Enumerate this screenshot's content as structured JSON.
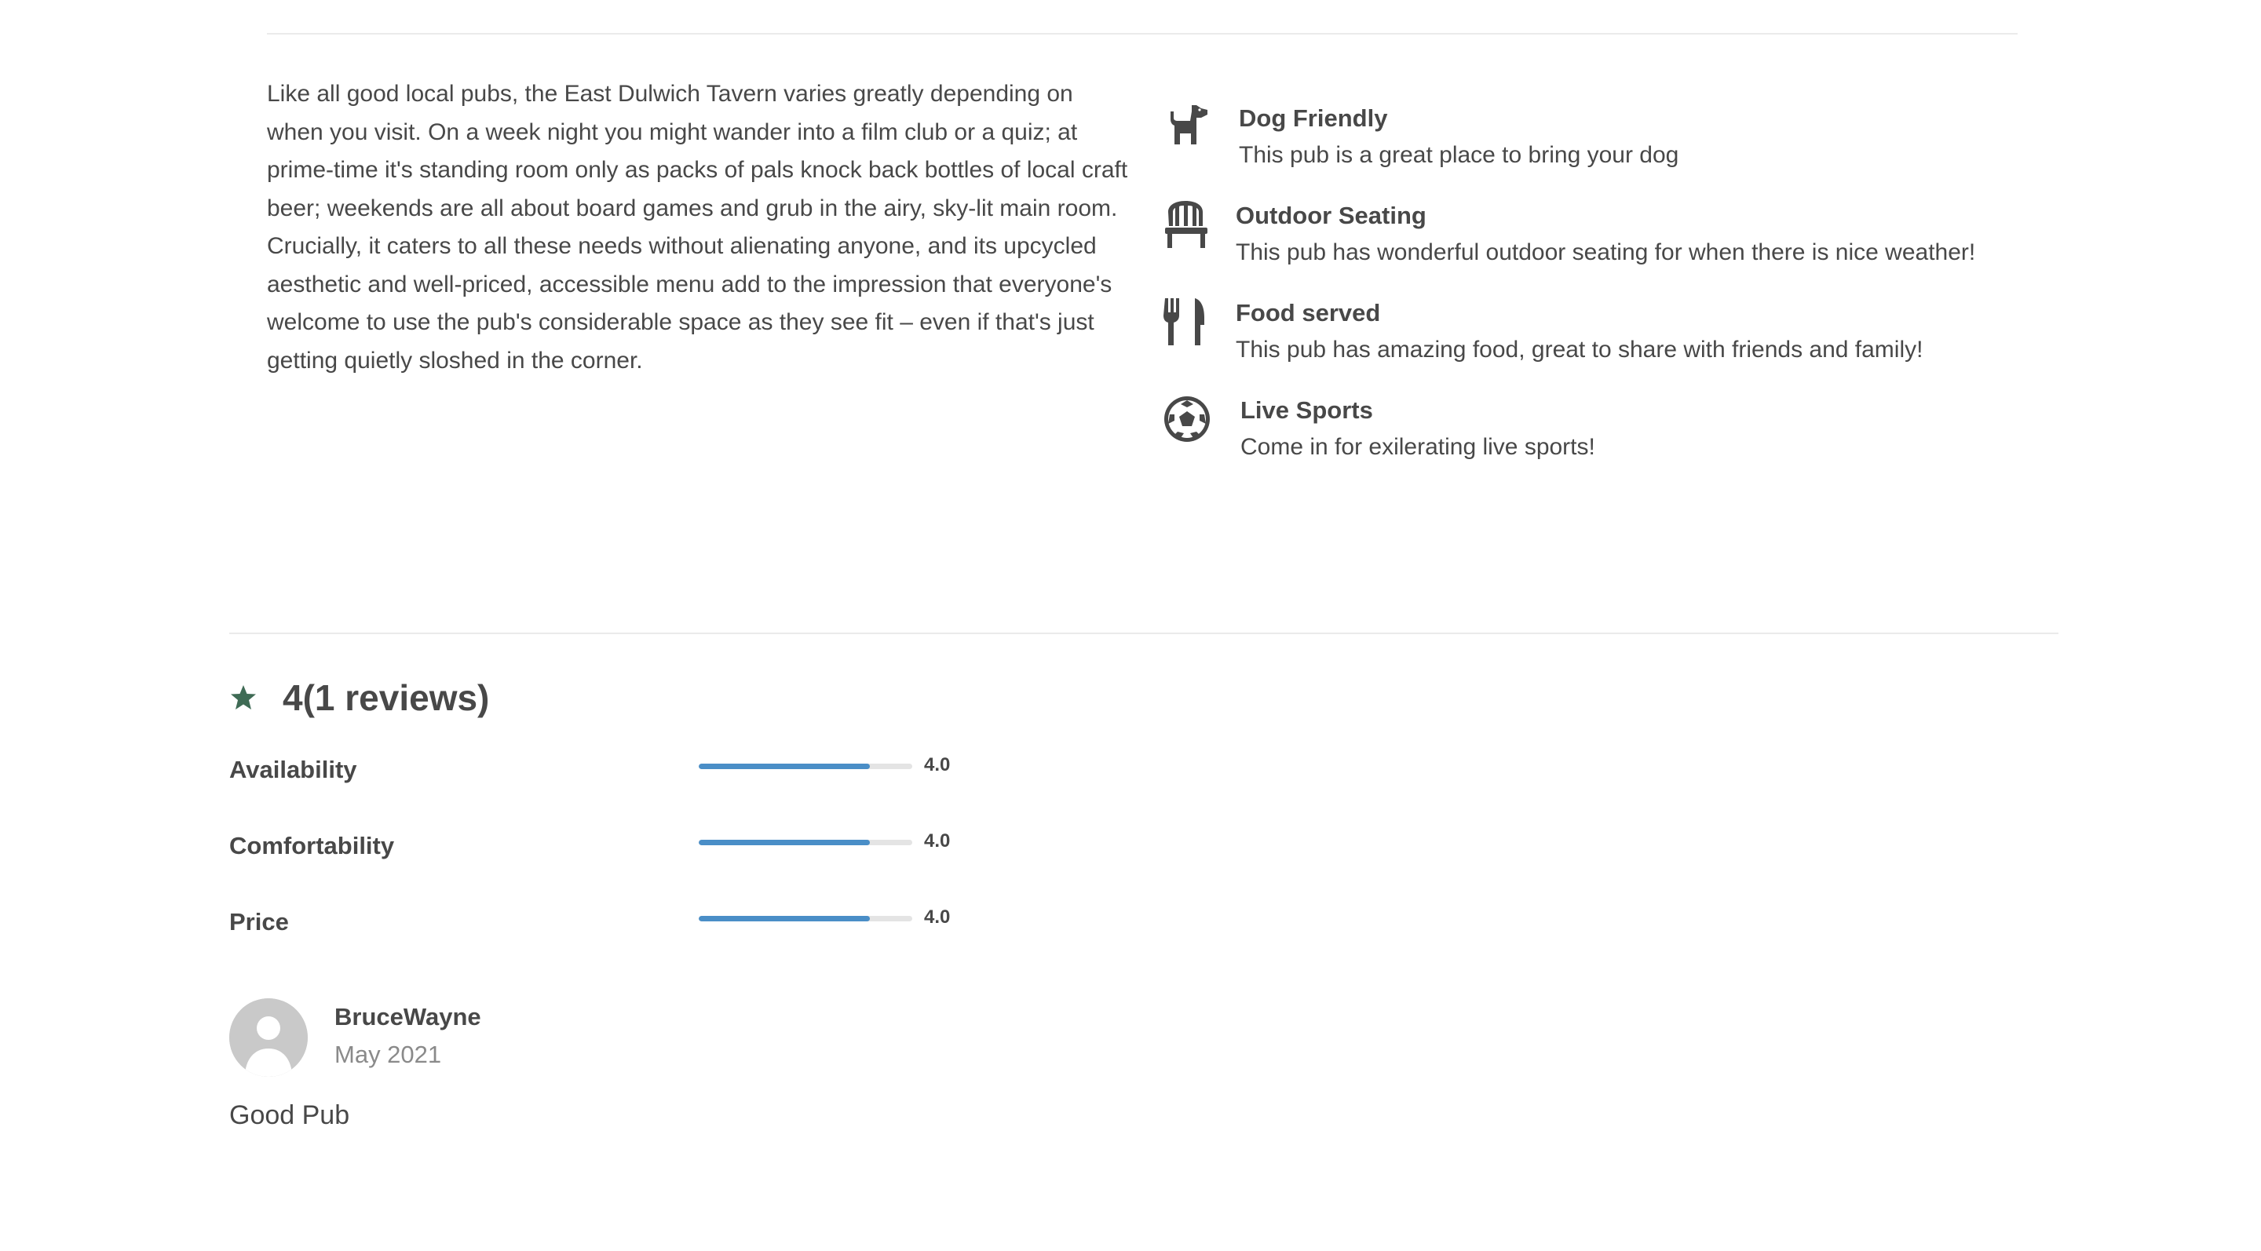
{
  "pub": {
    "description": "Like all good local pubs, the East Dulwich Tavern varies greatly depending on when you visit. On a week night you might wander into a film club or a quiz; at prime-time it's standing room only as packs of pals knock back bottles of local craft beer; weekends are all about board games and grub in the airy, sky-lit main room. Crucially, it caters to all these needs without alienating anyone, and its upcycled aesthetic and well-priced, accessible menu add to the impression that everyone's welcome to use the pub's considerable space as they see fit – even if that's just getting quietly sloshed in the corner."
  },
  "amenities": [
    {
      "icon": "dog-icon",
      "title": "Dog Friendly",
      "desc": "This pub is a great place to bring your dog"
    },
    {
      "icon": "chair-icon",
      "title": "Outdoor Seating",
      "desc": "This pub has wonderful outdoor seating for when there is nice weather!"
    },
    {
      "icon": "utensils-icon",
      "title": "Food served",
      "desc": "This pub has amazing food, great to share with friends and family!"
    },
    {
      "icon": "soccer-ball-icon",
      "title": "Live Sports",
      "desc": "Come in for exilerating live sports!"
    }
  ],
  "ratings": {
    "summary": "4(1 reviews)",
    "accent_color": "#3f6b55",
    "bar_color": "#4a8ec7",
    "max": 5,
    "categories": [
      {
        "label": "Availability",
        "value": 4.0,
        "display": "4.0"
      },
      {
        "label": "Comfortability",
        "value": 4.0,
        "display": "4.0"
      },
      {
        "label": "Price",
        "value": 4.0,
        "display": "4.0"
      }
    ]
  },
  "review": {
    "author": "BruceWayne",
    "date": "May 2021",
    "text": "Good Pub"
  }
}
